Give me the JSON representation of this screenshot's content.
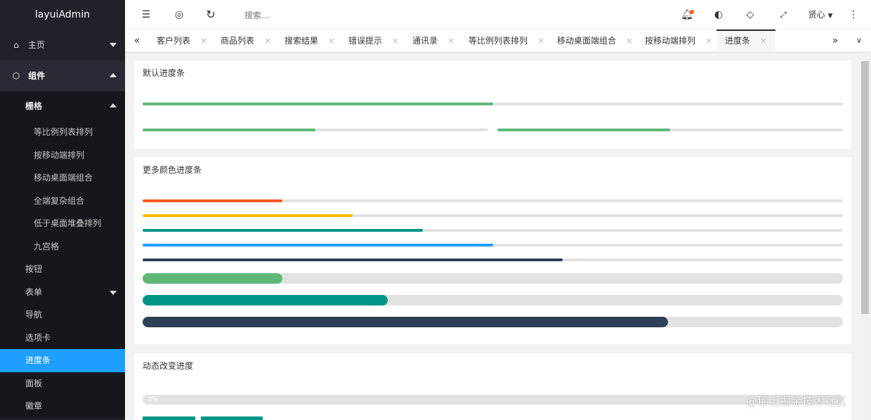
{
  "app": {
    "title": "layuiAdmin"
  },
  "sidebar": {
    "items": [
      {
        "label": "主页",
        "icon": "home-icon"
      },
      {
        "label": "组件",
        "icon": "cube-icon"
      }
    ],
    "submenu_label": "栅格",
    "grid_children": [
      "等比例列表排列",
      "按移动端排列",
      "移动桌面端组合",
      "全端复杂组合",
      "低于桌面堆叠排列",
      "九宫格"
    ],
    "component_items": [
      {
        "label": "按钮"
      },
      {
        "label": "表单"
      },
      {
        "label": "导航"
      },
      {
        "label": "选项卡"
      },
      {
        "label": "进度条"
      },
      {
        "label": "面板"
      },
      {
        "label": "徽章"
      }
    ]
  },
  "header": {
    "search_placeholder": "搜索...",
    "user_name": "贤心"
  },
  "tabs": [
    {
      "label": "客户列表"
    },
    {
      "label": "商品列表"
    },
    {
      "label": "搜索结果"
    },
    {
      "label": "错误提示"
    },
    {
      "label": "通讯录"
    },
    {
      "label": "等比例列表排列"
    },
    {
      "label": "移动桌面端组合"
    },
    {
      "label": "按移动端排列"
    },
    {
      "label": "进度条"
    }
  ],
  "tab_close": "×",
  "cards": {
    "default": {
      "title": "默认进度条"
    },
    "colors": {
      "title": "更多颜色进度条"
    },
    "dynamic": {
      "title": "动态改变进度",
      "progress_text": "0%"
    }
  },
  "progress": {
    "default_full": 0.5,
    "default_half_left": 0.5,
    "default_half_right": 0.5,
    "thin": [
      {
        "color": "#ff5722",
        "value": 0.2
      },
      {
        "color": "#ffb800",
        "value": 0.3
      },
      {
        "color": "#009688",
        "value": 0.4
      },
      {
        "color": "#1e9fff",
        "value": 0.5
      },
      {
        "color": "#2f4056",
        "value": 0.6
      }
    ],
    "big": [
      {
        "color": "#5fb878",
        "value": 0.2
      },
      {
        "color": "#009688",
        "value": 0.35
      },
      {
        "color": "#2f4056",
        "value": 0.75
      }
    ],
    "dynamic_value": 0
  },
  "colors": {
    "green": "#5fb878",
    "sidebar_bg": "#20222a",
    "active_blue": "#1e9fff"
  },
  "watermark": "@稀土掘金技术社区"
}
